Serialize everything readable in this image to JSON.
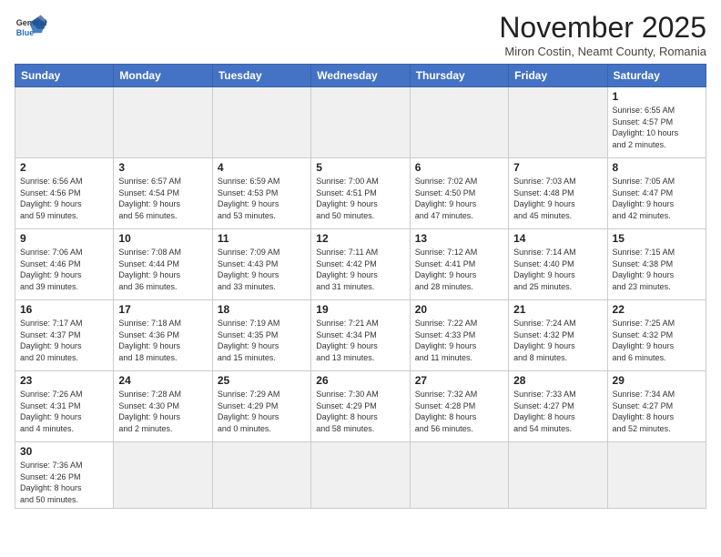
{
  "header": {
    "logo_general": "General",
    "logo_blue": "Blue",
    "month_title": "November 2025",
    "subtitle": "Miron Costin, Neamt County, Romania"
  },
  "weekdays": [
    "Sunday",
    "Monday",
    "Tuesday",
    "Wednesday",
    "Thursday",
    "Friday",
    "Saturday"
  ],
  "days": [
    {
      "num": "",
      "info": ""
    },
    {
      "num": "",
      "info": ""
    },
    {
      "num": "",
      "info": ""
    },
    {
      "num": "",
      "info": ""
    },
    {
      "num": "",
      "info": ""
    },
    {
      "num": "",
      "info": ""
    },
    {
      "num": "1",
      "info": "Sunrise: 6:55 AM\nSunset: 4:57 PM\nDaylight: 10 hours\nand 2 minutes."
    },
    {
      "num": "2",
      "info": "Sunrise: 6:56 AM\nSunset: 4:56 PM\nDaylight: 9 hours\nand 59 minutes."
    },
    {
      "num": "3",
      "info": "Sunrise: 6:57 AM\nSunset: 4:54 PM\nDaylight: 9 hours\nand 56 minutes."
    },
    {
      "num": "4",
      "info": "Sunrise: 6:59 AM\nSunset: 4:53 PM\nDaylight: 9 hours\nand 53 minutes."
    },
    {
      "num": "5",
      "info": "Sunrise: 7:00 AM\nSunset: 4:51 PM\nDaylight: 9 hours\nand 50 minutes."
    },
    {
      "num": "6",
      "info": "Sunrise: 7:02 AM\nSunset: 4:50 PM\nDaylight: 9 hours\nand 47 minutes."
    },
    {
      "num": "7",
      "info": "Sunrise: 7:03 AM\nSunset: 4:48 PM\nDaylight: 9 hours\nand 45 minutes."
    },
    {
      "num": "8",
      "info": "Sunrise: 7:05 AM\nSunset: 4:47 PM\nDaylight: 9 hours\nand 42 minutes."
    },
    {
      "num": "9",
      "info": "Sunrise: 7:06 AM\nSunset: 4:46 PM\nDaylight: 9 hours\nand 39 minutes."
    },
    {
      "num": "10",
      "info": "Sunrise: 7:08 AM\nSunset: 4:44 PM\nDaylight: 9 hours\nand 36 minutes."
    },
    {
      "num": "11",
      "info": "Sunrise: 7:09 AM\nSunset: 4:43 PM\nDaylight: 9 hours\nand 33 minutes."
    },
    {
      "num": "12",
      "info": "Sunrise: 7:11 AM\nSunset: 4:42 PM\nDaylight: 9 hours\nand 31 minutes."
    },
    {
      "num": "13",
      "info": "Sunrise: 7:12 AM\nSunset: 4:41 PM\nDaylight: 9 hours\nand 28 minutes."
    },
    {
      "num": "14",
      "info": "Sunrise: 7:14 AM\nSunset: 4:40 PM\nDaylight: 9 hours\nand 25 minutes."
    },
    {
      "num": "15",
      "info": "Sunrise: 7:15 AM\nSunset: 4:38 PM\nDaylight: 9 hours\nand 23 minutes."
    },
    {
      "num": "16",
      "info": "Sunrise: 7:17 AM\nSunset: 4:37 PM\nDaylight: 9 hours\nand 20 minutes."
    },
    {
      "num": "17",
      "info": "Sunrise: 7:18 AM\nSunset: 4:36 PM\nDaylight: 9 hours\nand 18 minutes."
    },
    {
      "num": "18",
      "info": "Sunrise: 7:19 AM\nSunset: 4:35 PM\nDaylight: 9 hours\nand 15 minutes."
    },
    {
      "num": "19",
      "info": "Sunrise: 7:21 AM\nSunset: 4:34 PM\nDaylight: 9 hours\nand 13 minutes."
    },
    {
      "num": "20",
      "info": "Sunrise: 7:22 AM\nSunset: 4:33 PM\nDaylight: 9 hours\nand 11 minutes."
    },
    {
      "num": "21",
      "info": "Sunrise: 7:24 AM\nSunset: 4:32 PM\nDaylight: 9 hours\nand 8 minutes."
    },
    {
      "num": "22",
      "info": "Sunrise: 7:25 AM\nSunset: 4:32 PM\nDaylight: 9 hours\nand 6 minutes."
    },
    {
      "num": "23",
      "info": "Sunrise: 7:26 AM\nSunset: 4:31 PM\nDaylight: 9 hours\nand 4 minutes."
    },
    {
      "num": "24",
      "info": "Sunrise: 7:28 AM\nSunset: 4:30 PM\nDaylight: 9 hours\nand 2 minutes."
    },
    {
      "num": "25",
      "info": "Sunrise: 7:29 AM\nSunset: 4:29 PM\nDaylight: 9 hours\nand 0 minutes."
    },
    {
      "num": "26",
      "info": "Sunrise: 7:30 AM\nSunset: 4:29 PM\nDaylight: 8 hours\nand 58 minutes."
    },
    {
      "num": "27",
      "info": "Sunrise: 7:32 AM\nSunset: 4:28 PM\nDaylight: 8 hours\nand 56 minutes."
    },
    {
      "num": "28",
      "info": "Sunrise: 7:33 AM\nSunset: 4:27 PM\nDaylight: 8 hours\nand 54 minutes."
    },
    {
      "num": "29",
      "info": "Sunrise: 7:34 AM\nSunset: 4:27 PM\nDaylight: 8 hours\nand 52 minutes."
    },
    {
      "num": "30",
      "info": "Sunrise: 7:36 AM\nSunset: 4:26 PM\nDaylight: 8 hours\nand 50 minutes."
    },
    {
      "num": "",
      "info": ""
    },
    {
      "num": "",
      "info": ""
    },
    {
      "num": "",
      "info": ""
    },
    {
      "num": "",
      "info": ""
    },
    {
      "num": "",
      "info": ""
    }
  ]
}
